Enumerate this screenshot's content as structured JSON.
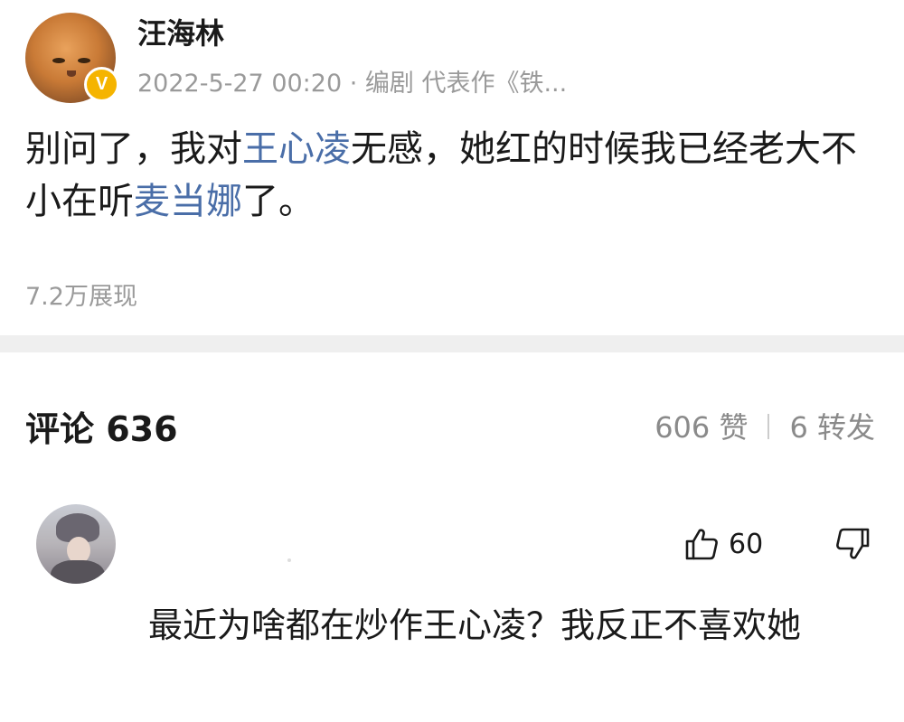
{
  "post": {
    "author": "汪海林",
    "verified_badge": "V",
    "meta": "2022-5-27 00:20 · 编剧 代表作《铁...",
    "body": {
      "part1": "别问了，我对",
      "link1": "王心凌",
      "part2": "无感，她红的时候我已经老大不小在听",
      "link2": "麦当娜",
      "part3": "了。"
    },
    "views": "7.2万展现"
  },
  "comments_header": {
    "title": "评论 636",
    "likes": "606 赞",
    "reposts": "6 转发"
  },
  "comment": {
    "like_count": "60",
    "text": "最近为啥都在炒作王心凌？我反正不喜欢她"
  },
  "icons": {
    "author_avatar": "cat-avatar",
    "verified": "verified-badge-icon",
    "thumbs_up": "thumbs-up-icon",
    "thumbs_down": "thumbs-down-icon"
  },
  "colors": {
    "link": "#4a6ea8",
    "verified": "#f5b400",
    "secondary_text": "#9a9a9a",
    "divider": "#efefef"
  }
}
